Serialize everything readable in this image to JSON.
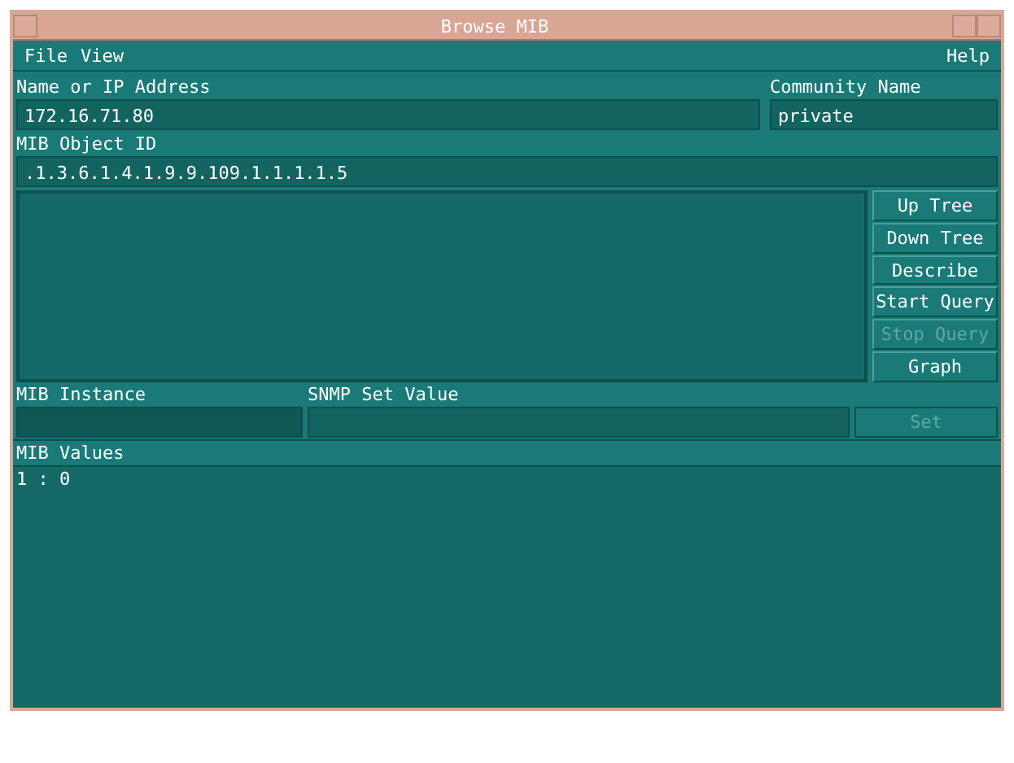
{
  "window": {
    "title": "Browse MIB"
  },
  "menu": {
    "left": [
      "File",
      "View"
    ],
    "right": [
      "Help"
    ]
  },
  "address": {
    "label": "Name or IP Address",
    "value": "172.16.71.80"
  },
  "community": {
    "label": "Community Name",
    "value": "private"
  },
  "object_id": {
    "label": "MIB Object ID",
    "value": ".1.3.6.1.4.1.9.9.109.1.1.1.1.5"
  },
  "tree_buttons": [
    {
      "label": "Up Tree",
      "disabled": false
    },
    {
      "label": "Down Tree",
      "disabled": false
    },
    {
      "label": "Describe",
      "disabled": false
    },
    {
      "label": "Start Query",
      "disabled": false
    },
    {
      "label": "Stop Query",
      "disabled": true
    },
    {
      "label": "Graph",
      "disabled": false
    }
  ],
  "instance": {
    "label": "MIB Instance"
  },
  "set_value": {
    "label": "SNMP Set Value"
  },
  "set_button": {
    "label": "Set",
    "disabled": true
  },
  "values": {
    "label": "MIB Values",
    "lines": [
      "1 : 0"
    ]
  }
}
